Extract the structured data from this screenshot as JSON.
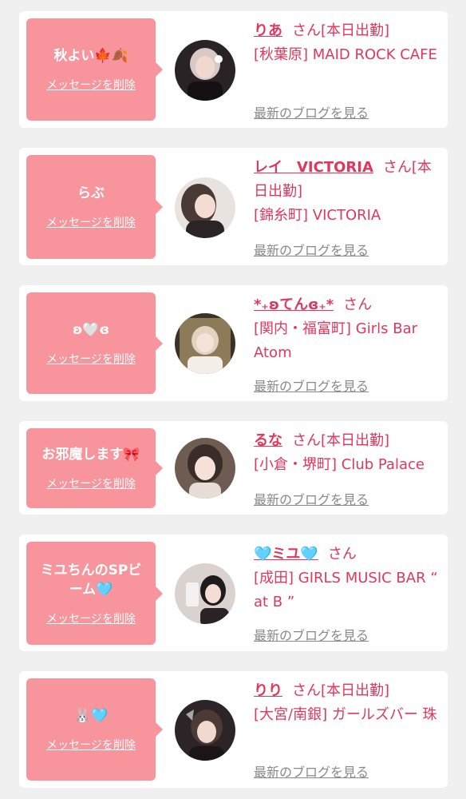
{
  "cards": [
    {
      "message": "秋よい🍁🍂",
      "delete_label": "メッセージを削除",
      "name": "りあ",
      "suffix": "さん[本日出勤]",
      "shop": "[秋葉原] MAID ROCK CAFE",
      "blog_label": "最新のブログを見る",
      "avatar_icon": "girl-photo"
    },
    {
      "message": "らぶ",
      "delete_label": "メッセージを削除",
      "name": "レイ　VICTORIA",
      "suffix": "さん[本日出勤]",
      "shop": "[錦糸町] VICTORIA",
      "blog_label": "最新のブログを見る",
      "avatar_icon": "girl-photo"
    },
    {
      "message": "ʚ🤍ɞ",
      "delete_label": "メッセージを削除",
      "name": "*₊ʚてんɞ₊*",
      "suffix": "さん",
      "shop": "[関内・福富町] Girls Bar Atom",
      "blog_label": "最新のブログを見る",
      "avatar_icon": "girl-photo"
    },
    {
      "message": "お邪魔します🎀",
      "delete_label": "メッセージを削除",
      "name": "るな",
      "suffix": "さん[本日出勤]",
      "shop": "[小倉・堺町] Club Palace",
      "blog_label": "最新のブログを見る",
      "avatar_icon": "girl-photo"
    },
    {
      "message": "ミユちんのSPビーム🩵",
      "delete_label": "メッセージを削除",
      "name": "🩵ミユ🩵",
      "suffix": "さん",
      "shop": "[成田] GIRLS MUSIC BAR “ at B ”",
      "blog_label": "最新のブログを見る",
      "avatar_icon": "girl-photo"
    },
    {
      "message": "🐰🩵",
      "delete_label": "メッセージを削除",
      "name": "りり",
      "suffix": "さん[本日出勤]",
      "shop": "[大宮/南銀] ガールズバー 珠",
      "blog_label": "最新のブログを見る",
      "avatar_icon": "girl-photo"
    }
  ],
  "colors": {
    "page_bg": "#f0f0f0",
    "card_bg": "#ffffff",
    "bubble_bg": "#f7949c",
    "name_color": "#e0375e",
    "link_gray": "#888888"
  }
}
